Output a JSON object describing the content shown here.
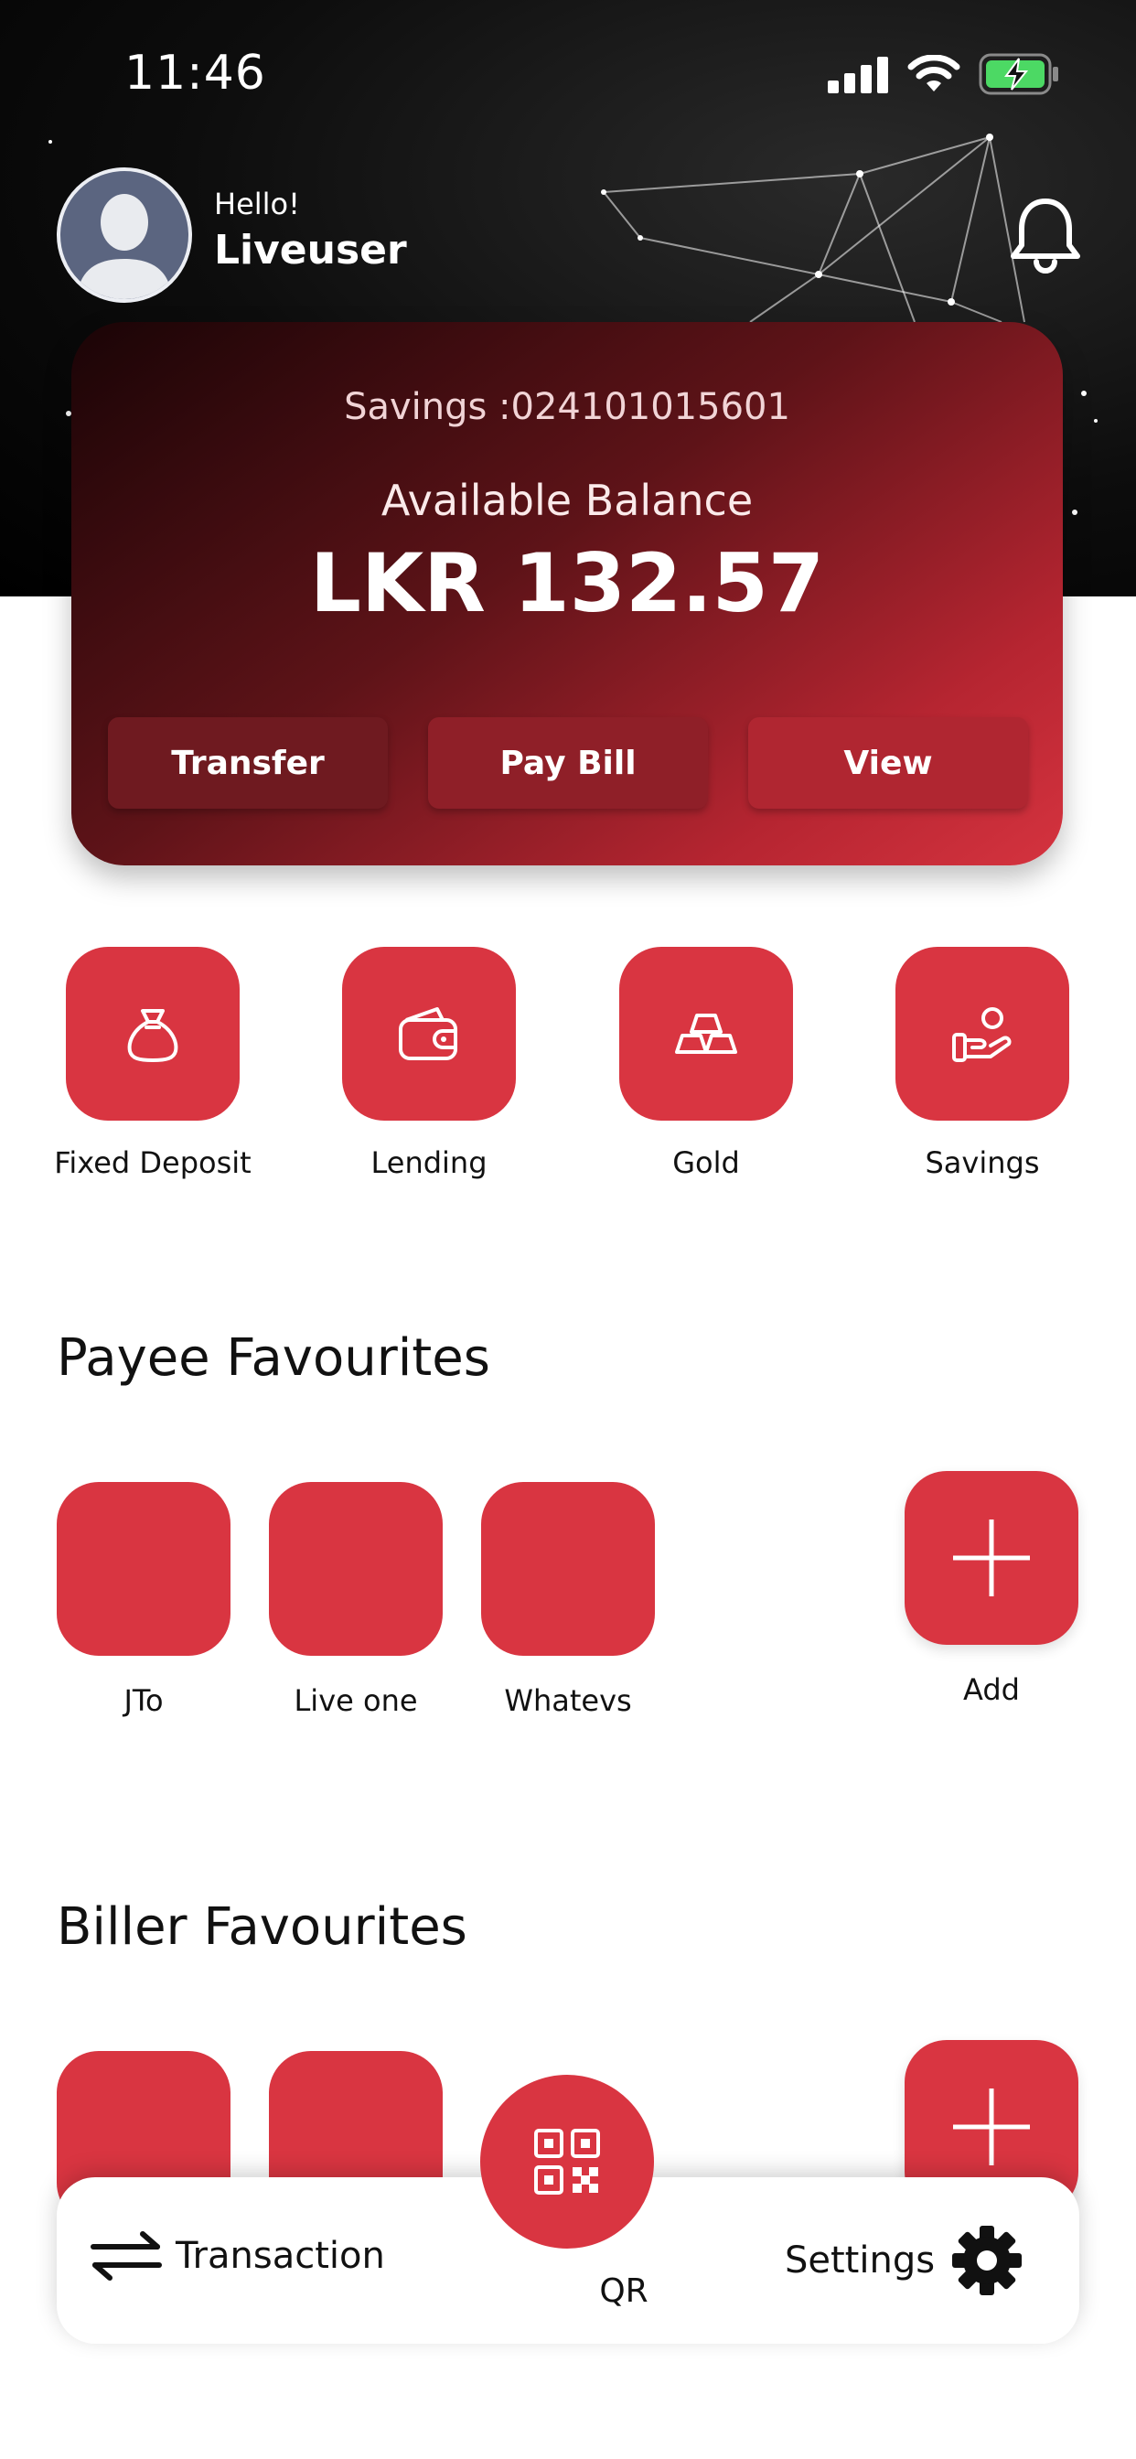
{
  "status_bar": {
    "time": "11:46"
  },
  "header": {
    "greeting": "Hello!",
    "username": "Liveuser"
  },
  "account_card": {
    "account": "Savings :024101015601",
    "balance_label": "Available Balance",
    "balance": "LKR 132.57",
    "buttons": [
      "Transfer",
      "Pay Bill",
      "View"
    ]
  },
  "quick_actions": [
    "Fixed Deposit",
    "Lending",
    "Gold",
    "Savings"
  ],
  "payee_favourites": {
    "title": "Payee Favourites",
    "items": [
      "JTo",
      "Live one",
      "Whatevs"
    ],
    "add_label": "Add"
  },
  "biller_favourites": {
    "title": "Biller Favourites"
  },
  "bottom_nav": {
    "transaction": "Transaction",
    "qr": "QR",
    "settings": "Settings"
  },
  "colors": {
    "brand_red": "#d93541",
    "card_dark": "#1a0406"
  }
}
